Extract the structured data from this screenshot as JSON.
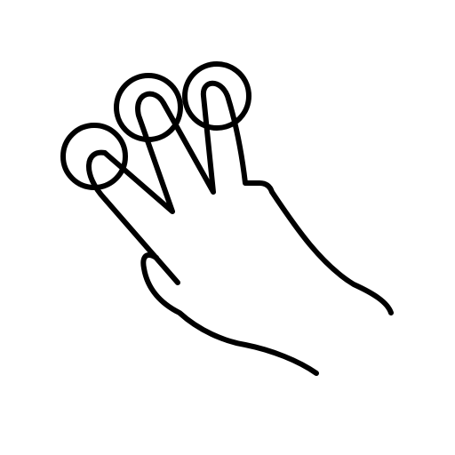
{
  "icon": {
    "name": "three-finger-touch-gesture-icon",
    "stroke_color": "#000000",
    "background_color": "#ffffff",
    "touch_points": 3
  }
}
